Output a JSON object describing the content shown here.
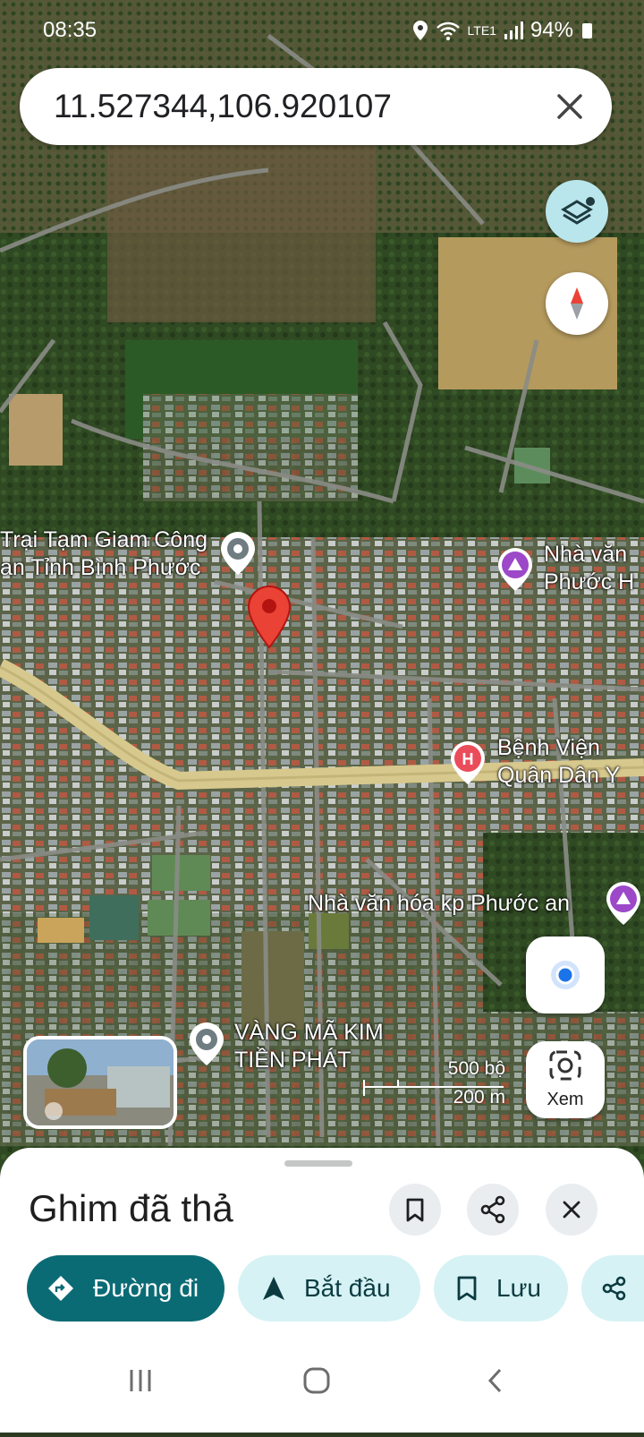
{
  "status_bar": {
    "time": "08:35",
    "network": "LTE1",
    "battery": "94%"
  },
  "search": {
    "query": "11.527344,106.920107"
  },
  "map_labels": {
    "detention_center": "Trại Tạm Giam Công\nan Tỉnh Bình Phước",
    "culture_house_top": "Nhà văn\nPhước H",
    "hospital": "Bệnh Viện\nQuân Dân Y",
    "culture_house_bottom": "Nhà văn hóa kp Phước an",
    "gold_shop": "VÀNG MÃ KIM\nTIỀN PHÁT"
  },
  "scale": {
    "imperial": "500 bộ",
    "metric": "200 m"
  },
  "lens_button": {
    "label": "Xem"
  },
  "sheet": {
    "title": "Ghim đã thả",
    "chips": [
      {
        "label": "Đường đi",
        "icon": "directions-icon"
      },
      {
        "label": "Bắt đầu",
        "icon": "navigation-arrow-icon"
      },
      {
        "label": "Lưu",
        "icon": "bookmark-icon"
      }
    ]
  },
  "colors": {
    "primary_chip": "#0b6b75",
    "secondary_chip": "#d6f2f4",
    "pin_red": "#ea4335",
    "road_yellow": "#d7c98d"
  }
}
